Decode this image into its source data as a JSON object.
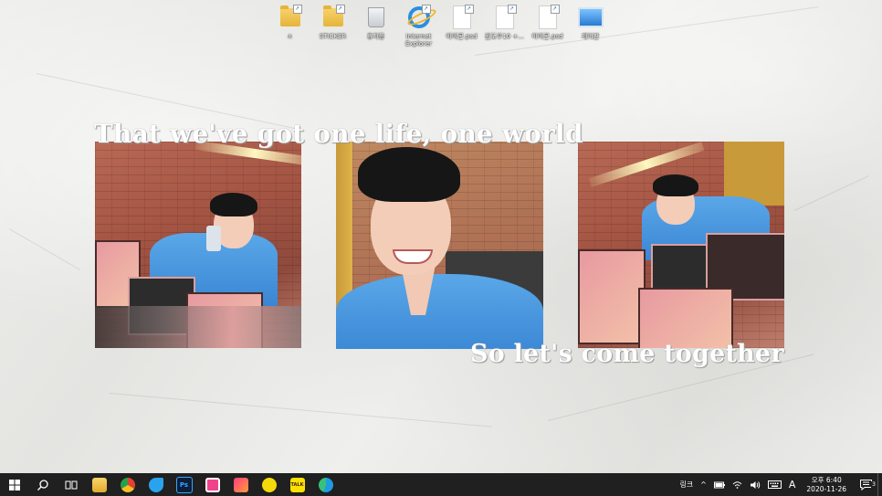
{
  "desktop": {
    "icons": [
      {
        "label": "ㅊ",
        "type": "folder"
      },
      {
        "label": "STICKER",
        "type": "folder"
      },
      {
        "label": "휴지통",
        "type": "recycle-bin"
      },
      {
        "label": "Internet Explorer",
        "type": "internet-explorer"
      },
      {
        "label": "아이콘.psd",
        "type": "document"
      },
      {
        "label": "윈도우10 +...",
        "type": "document"
      },
      {
        "label": "아이콘.psd",
        "type": "document"
      },
      {
        "label": "제어판",
        "type": "control-panel"
      }
    ]
  },
  "wallpaper": {
    "quote_top": "That we've got one life, one world",
    "quote_bottom": "So let's come together"
  },
  "taskbar": {
    "apps": [
      {
        "name": "file-explorer",
        "color": "#f4c542"
      },
      {
        "name": "chrome",
        "color": "#e34133"
      },
      {
        "name": "twitter-app",
        "color": "#2aa3ef"
      },
      {
        "name": "photoshop",
        "color": "#0c1e3a"
      },
      {
        "name": "app-pink",
        "color": "#f0438c"
      },
      {
        "name": "app-gradient",
        "color": "#ff5f6d"
      },
      {
        "name": "kakao-app",
        "color": "#f5d90a"
      },
      {
        "name": "kakaotalk",
        "color": "#fae100"
      },
      {
        "name": "edge",
        "color": "#1f9be0"
      }
    ],
    "tray": {
      "link_label": "링크",
      "ime_label": "A",
      "time": "오후 6:40",
      "date": "2020-11-26",
      "notification_count": "3"
    }
  }
}
